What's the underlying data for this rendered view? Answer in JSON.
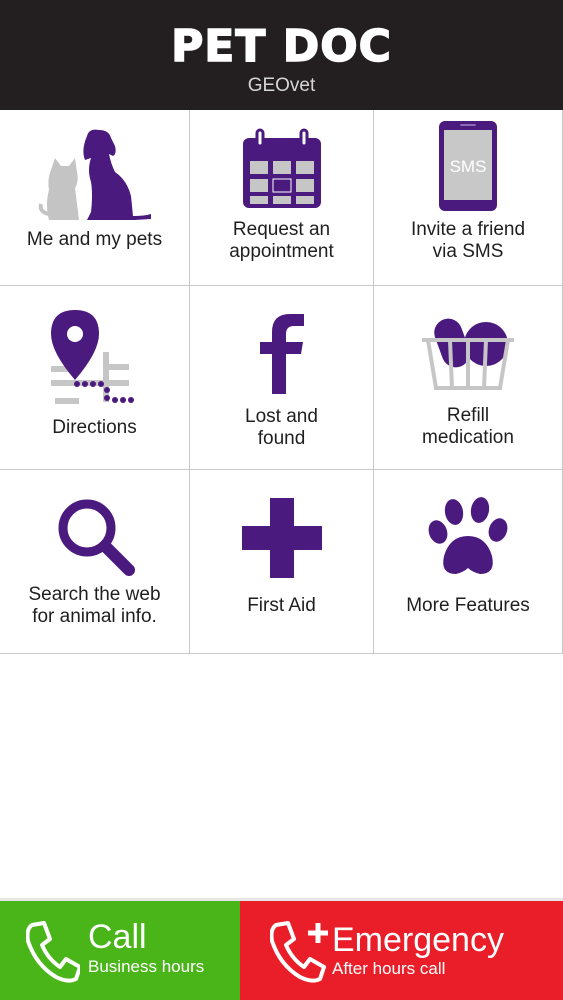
{
  "header": {
    "title": "PET DOC",
    "subtitle": "GEOvet"
  },
  "tiles": [
    {
      "label": "Me and my pets",
      "icon": "pets-icon"
    },
    {
      "label": "Request an\nappointment",
      "icon": "calendar-icon"
    },
    {
      "label": "Invite a friend\nvia SMS",
      "icon": "sms-phone-icon",
      "icon_text": "SMS"
    },
    {
      "label": "Directions",
      "icon": "map-pin-icon"
    },
    {
      "label": "Lost and\nfound",
      "icon": "facebook-icon",
      "icon_text": "f"
    },
    {
      "label": "Refill\nmedication",
      "icon": "basket-icon"
    },
    {
      "label": "Search the web\nfor animal info.",
      "icon": "search-icon"
    },
    {
      "label": "First Aid",
      "icon": "first-aid-cross-icon"
    },
    {
      "label": "More Features",
      "icon": "paw-icon"
    }
  ],
  "actions": {
    "call": {
      "title": "Call",
      "subtitle": "Business hours",
      "icon": "phone-icon"
    },
    "emergency": {
      "title": "Emergency",
      "subtitle": "After hours call",
      "icon": "phone-plus-icon"
    }
  },
  "colors": {
    "accent": "#4b1a7e",
    "header_bg": "#231f20",
    "call_green": "#4ab519",
    "emergency_red": "#ea1e29"
  }
}
